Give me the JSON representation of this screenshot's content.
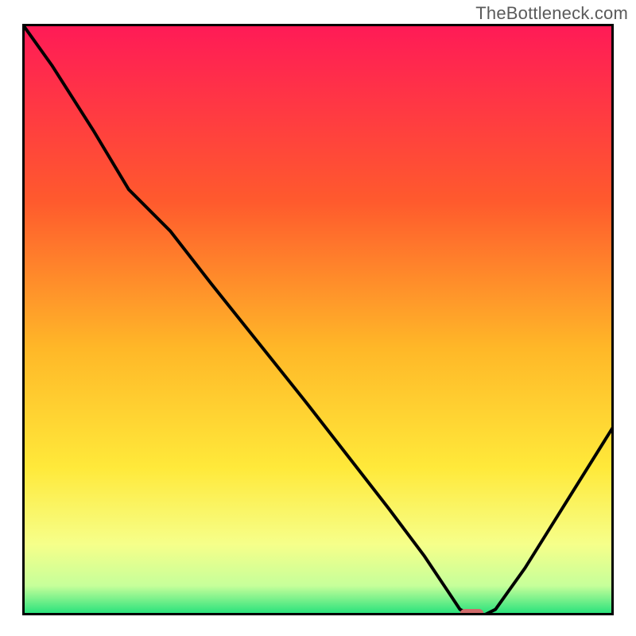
{
  "watermark": "TheBottleneck.com",
  "chart_data": {
    "type": "line",
    "title": "",
    "xlabel": "",
    "ylabel": "",
    "xlim": [
      0,
      100
    ],
    "ylim": [
      0,
      100
    ],
    "x": [
      0,
      5,
      12,
      18,
      25,
      32,
      40,
      48,
      55,
      62,
      68,
      72,
      74,
      76,
      78,
      80,
      85,
      90,
      95,
      100
    ],
    "values": [
      100,
      93,
      82,
      72,
      65,
      56,
      46,
      36,
      27,
      18,
      10,
      4,
      1,
      0,
      0,
      1,
      8,
      16,
      24,
      32
    ],
    "marker": {
      "x_start": 74,
      "x_end": 78,
      "y": 0
    },
    "gradient_stops": [
      {
        "offset": 0,
        "color": "#ff1a57"
      },
      {
        "offset": 30,
        "color": "#ff5a2d"
      },
      {
        "offset": 55,
        "color": "#ffb828"
      },
      {
        "offset": 75,
        "color": "#ffe93a"
      },
      {
        "offset": 88,
        "color": "#f6ff8a"
      },
      {
        "offset": 95,
        "color": "#c6ff9a"
      },
      {
        "offset": 100,
        "color": "#1fe07a"
      }
    ],
    "frame_color": "#000000",
    "marker_color": "#d06a6a",
    "curve_color": "#000000"
  }
}
